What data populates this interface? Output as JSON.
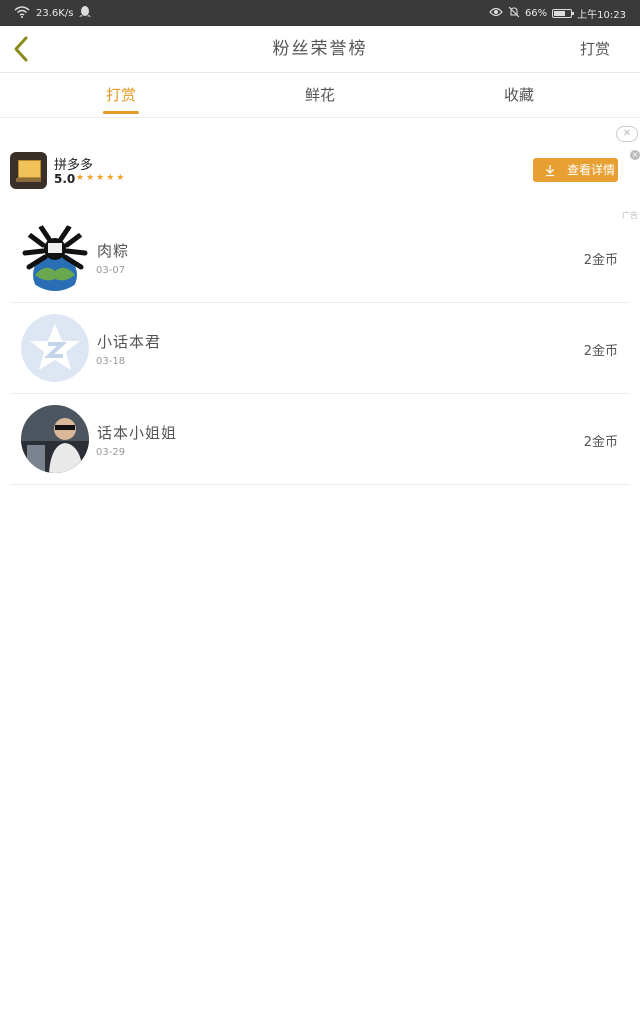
{
  "status_bar": {
    "net_speed": "23.6K/s",
    "battery": "66%",
    "battery_level": 0.66,
    "time": "上午10:23"
  },
  "nav": {
    "title": "粉丝荣誉榜",
    "action": "打赏"
  },
  "tabs": [
    {
      "label": "打赏",
      "active": true
    },
    {
      "label": "鲜花",
      "active": false
    },
    {
      "label": "收藏",
      "active": false
    }
  ],
  "ad": {
    "app_name": "拼多多",
    "rating": "5.0",
    "stars": "★★★★★",
    "button_label": "查看详情",
    "tag": "广告"
  },
  "fans": [
    {
      "name": "肉粽",
      "date": "03-07",
      "amount": "2金币"
    },
    {
      "name": "小话本君",
      "date": "03-18",
      "amount": "2金币"
    },
    {
      "name": "话本小姐姐",
      "date": "03-29",
      "amount": "2金币"
    }
  ],
  "colors": {
    "accent": "#e39a24",
    "status_bar": "#3a3a3a"
  }
}
